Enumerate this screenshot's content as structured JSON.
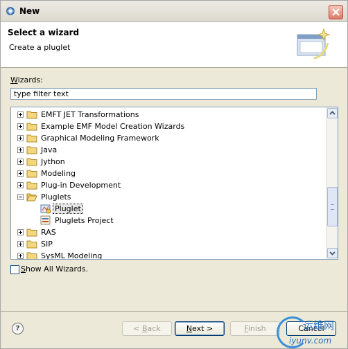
{
  "window": {
    "title": "New"
  },
  "banner": {
    "heading": "Select a wizard",
    "description": "Create a pluglet"
  },
  "wizards_label": "Wizards:",
  "filter": {
    "value": "type filter text"
  },
  "tree": {
    "items": [
      {
        "label": "EMFT JET Transformations",
        "expanded": false
      },
      {
        "label": "Example EMF Model Creation Wizards",
        "expanded": false
      },
      {
        "label": "Graphical Modeling Framework",
        "expanded": false
      },
      {
        "label": "Java",
        "expanded": false
      },
      {
        "label": "Jython",
        "expanded": false
      },
      {
        "label": "Modeling",
        "expanded": false
      },
      {
        "label": "Plug-in Development",
        "expanded": false
      },
      {
        "label": "Pluglets",
        "expanded": true
      },
      {
        "label": "Pluglet",
        "child": true,
        "selected": true
      },
      {
        "label": "Pluglets Project",
        "child": true
      },
      {
        "label": "RAS",
        "expanded": false
      },
      {
        "label": "SIP",
        "expanded": false
      },
      {
        "label": "SysML Modeling",
        "expanded": false
      }
    ]
  },
  "show_all": {
    "label": "Show All Wizards.",
    "checked": false
  },
  "buttons": {
    "help": "?",
    "back": "< Back",
    "next": "Next >",
    "finish": "Finish",
    "cancel": "Cancel"
  },
  "watermark": {
    "line1": "运维网",
    "line2": "iyunv.com"
  }
}
